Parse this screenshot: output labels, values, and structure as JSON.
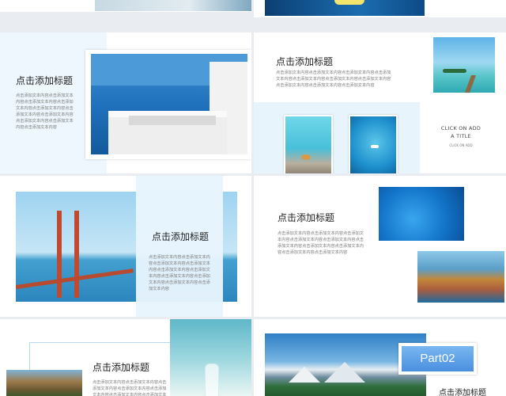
{
  "slides": {
    "title": "点击添加标题",
    "body_text": "点击添加文本内容点击添加文本内容点击添加文本内容点击添加文本内容点击添加文本内容点击添加文本内容点击添加文本内容点击添加文本内容点击添加文本内容点击添加文本内容",
    "click_add_title": [
      "CLICK ON ADD",
      "A TITLE"
    ],
    "click_add_sub": "CLICK ON ADD",
    "part_label": "Part02"
  },
  "colors": {
    "accent_blue": "#4a8fe0",
    "tint_blue": "#e9f5fd",
    "slide_bg": "#ffffff",
    "canvas_bg": "#e9edf1"
  },
  "icons": [
    "white-building-photo",
    "golden-gate-bridge-photo",
    "mountain-lake-photo"
  ]
}
